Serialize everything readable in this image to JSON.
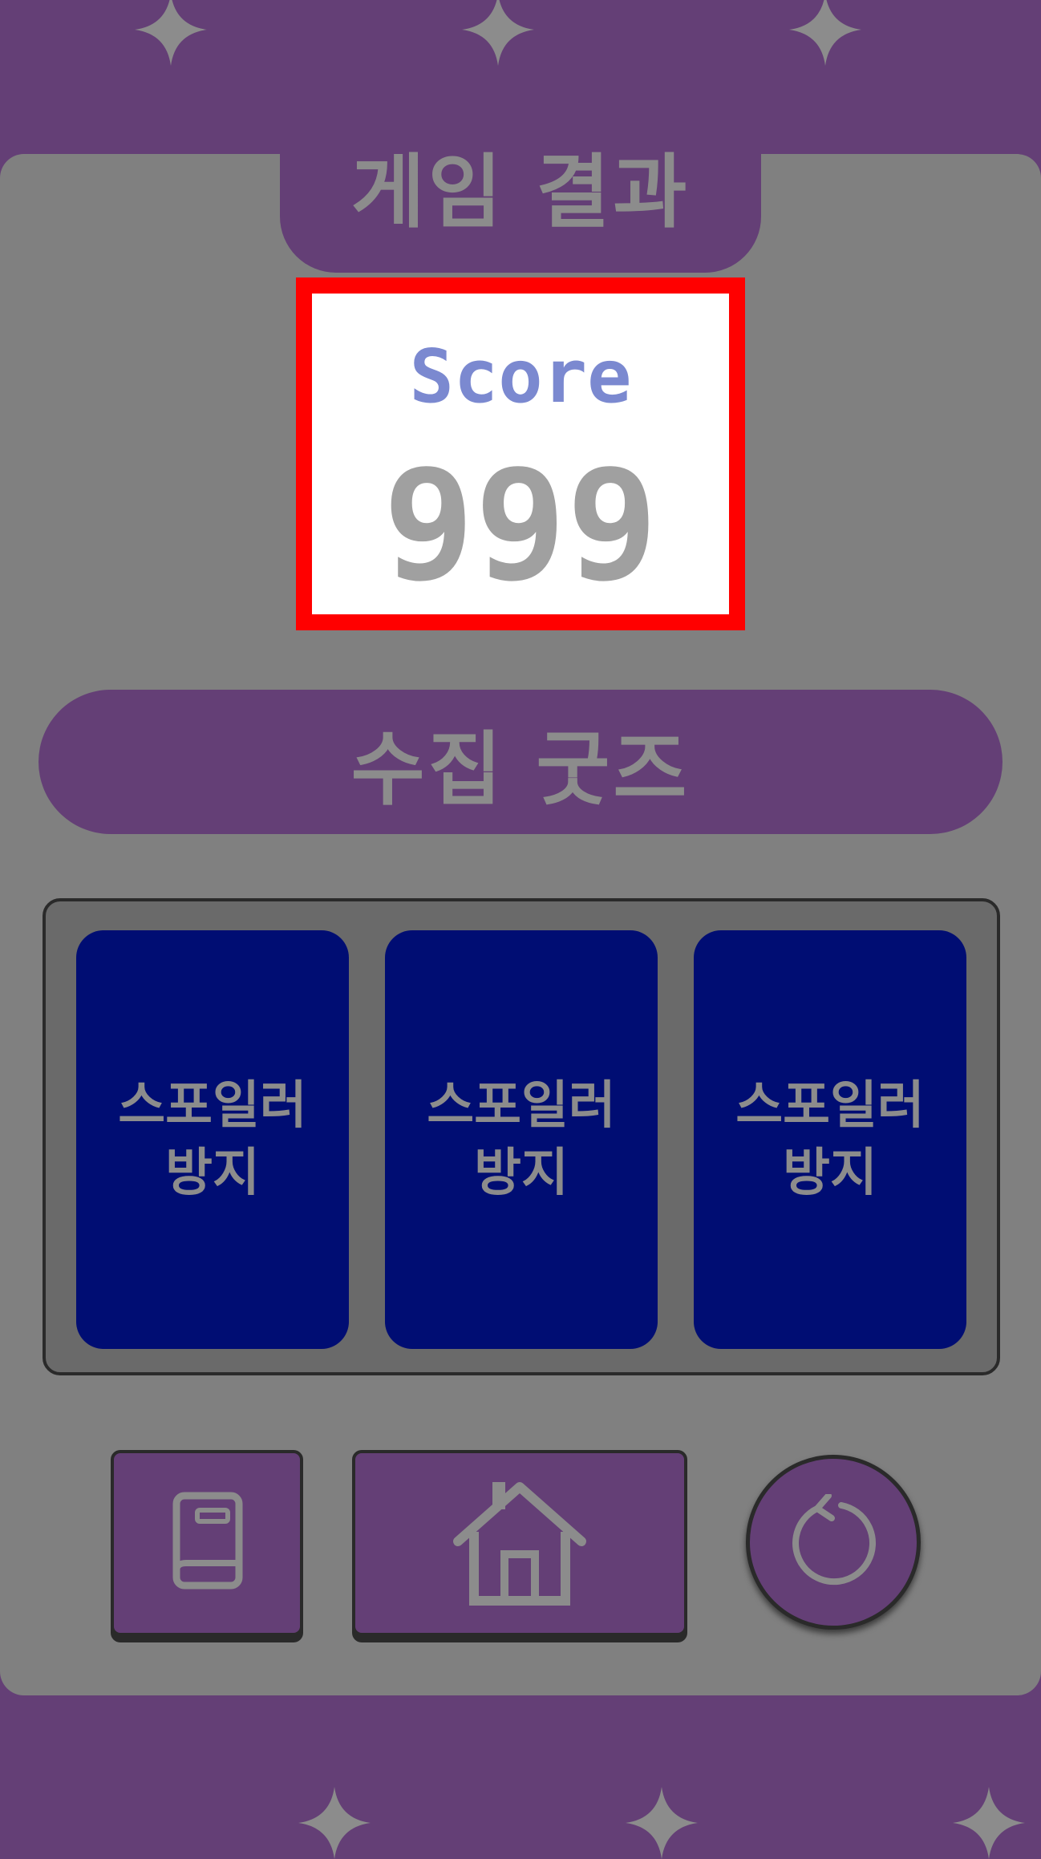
{
  "result_title": "게임 결과",
  "score": {
    "label": "Score",
    "value": "999"
  },
  "goods": {
    "title": "수집 굿즈",
    "cards": [
      {
        "label": "스포일러\n방지"
      },
      {
        "label": "스포일러\n방지"
      },
      {
        "label": "스포일러\n방지"
      }
    ]
  },
  "buttons": {
    "book_icon": "book-icon",
    "home_icon": "home-icon",
    "retry_icon": "retry-icon"
  },
  "colors": {
    "background": "#643f76",
    "panel": "#808080",
    "score_border": "#ff0000",
    "score_label": "#7b89d0",
    "card": "#000d73",
    "text_gray": "#8c8c8c"
  }
}
